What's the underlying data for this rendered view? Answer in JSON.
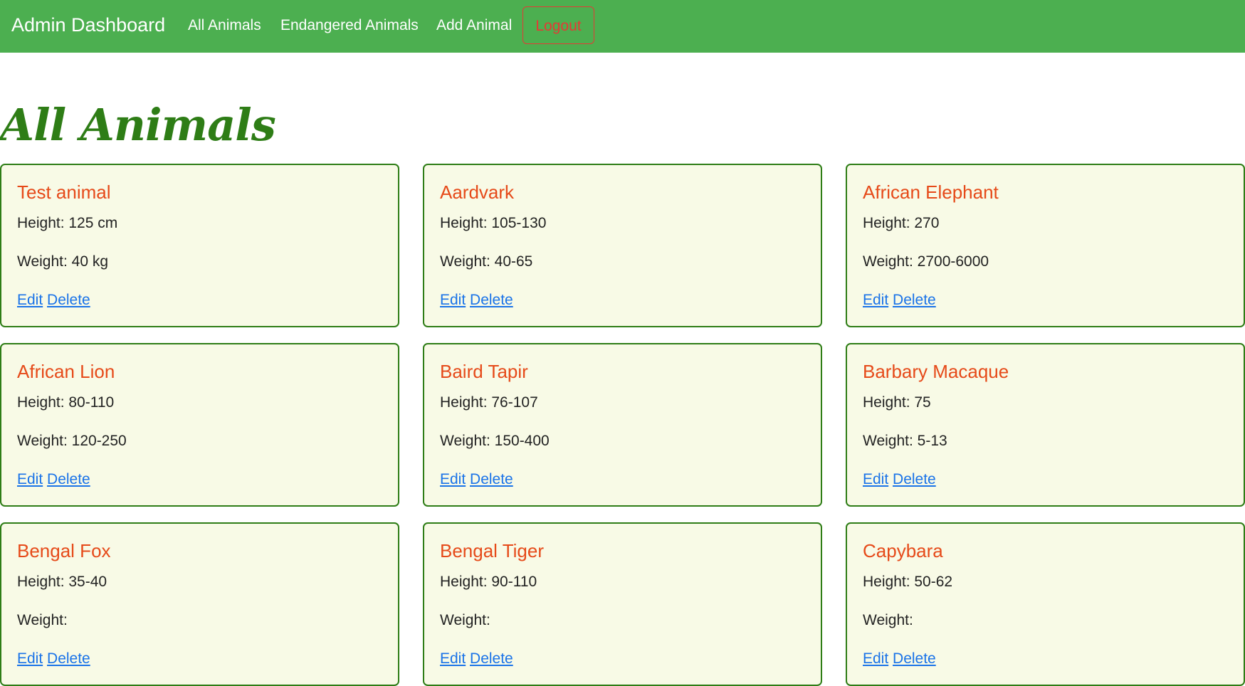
{
  "nav": {
    "brand": "Admin Dashboard",
    "links": [
      {
        "label": "All Animals"
      },
      {
        "label": "Endangered Animals"
      },
      {
        "label": "Add Animal"
      }
    ],
    "logout_label": "Logout"
  },
  "main": {
    "title": "All Animals",
    "edit_label": "Edit",
    "delete_label": "Delete",
    "height_prefix": "Height: ",
    "weight_prefix": "Weight: ",
    "animals": [
      {
        "name": "Test animal",
        "height": "125 cm",
        "weight": "40 kg"
      },
      {
        "name": "Aardvark",
        "height": "105-130",
        "weight": "40-65"
      },
      {
        "name": "African Elephant",
        "height": "270",
        "weight": "2700-6000"
      },
      {
        "name": "African Lion",
        "height": "80-110",
        "weight": "120-250"
      },
      {
        "name": "Baird Tapir",
        "height": "76-107",
        "weight": "150-400"
      },
      {
        "name": "Barbary Macaque",
        "height": "75",
        "weight": "5-13"
      },
      {
        "name": "Bengal Fox",
        "height": "35-40",
        "weight": ""
      },
      {
        "name": "Bengal Tiger",
        "height": "90-110",
        "weight": ""
      },
      {
        "name": "Capybara",
        "height": "50-62",
        "weight": ""
      }
    ]
  },
  "colors": {
    "navbar": "#4caf50",
    "title": "#2e7d16",
    "card_border": "#2e7d16",
    "card_bg": "#f8fae6",
    "animal_name": "#e64a19",
    "link": "#1a73e8",
    "logout": "#e53935"
  }
}
